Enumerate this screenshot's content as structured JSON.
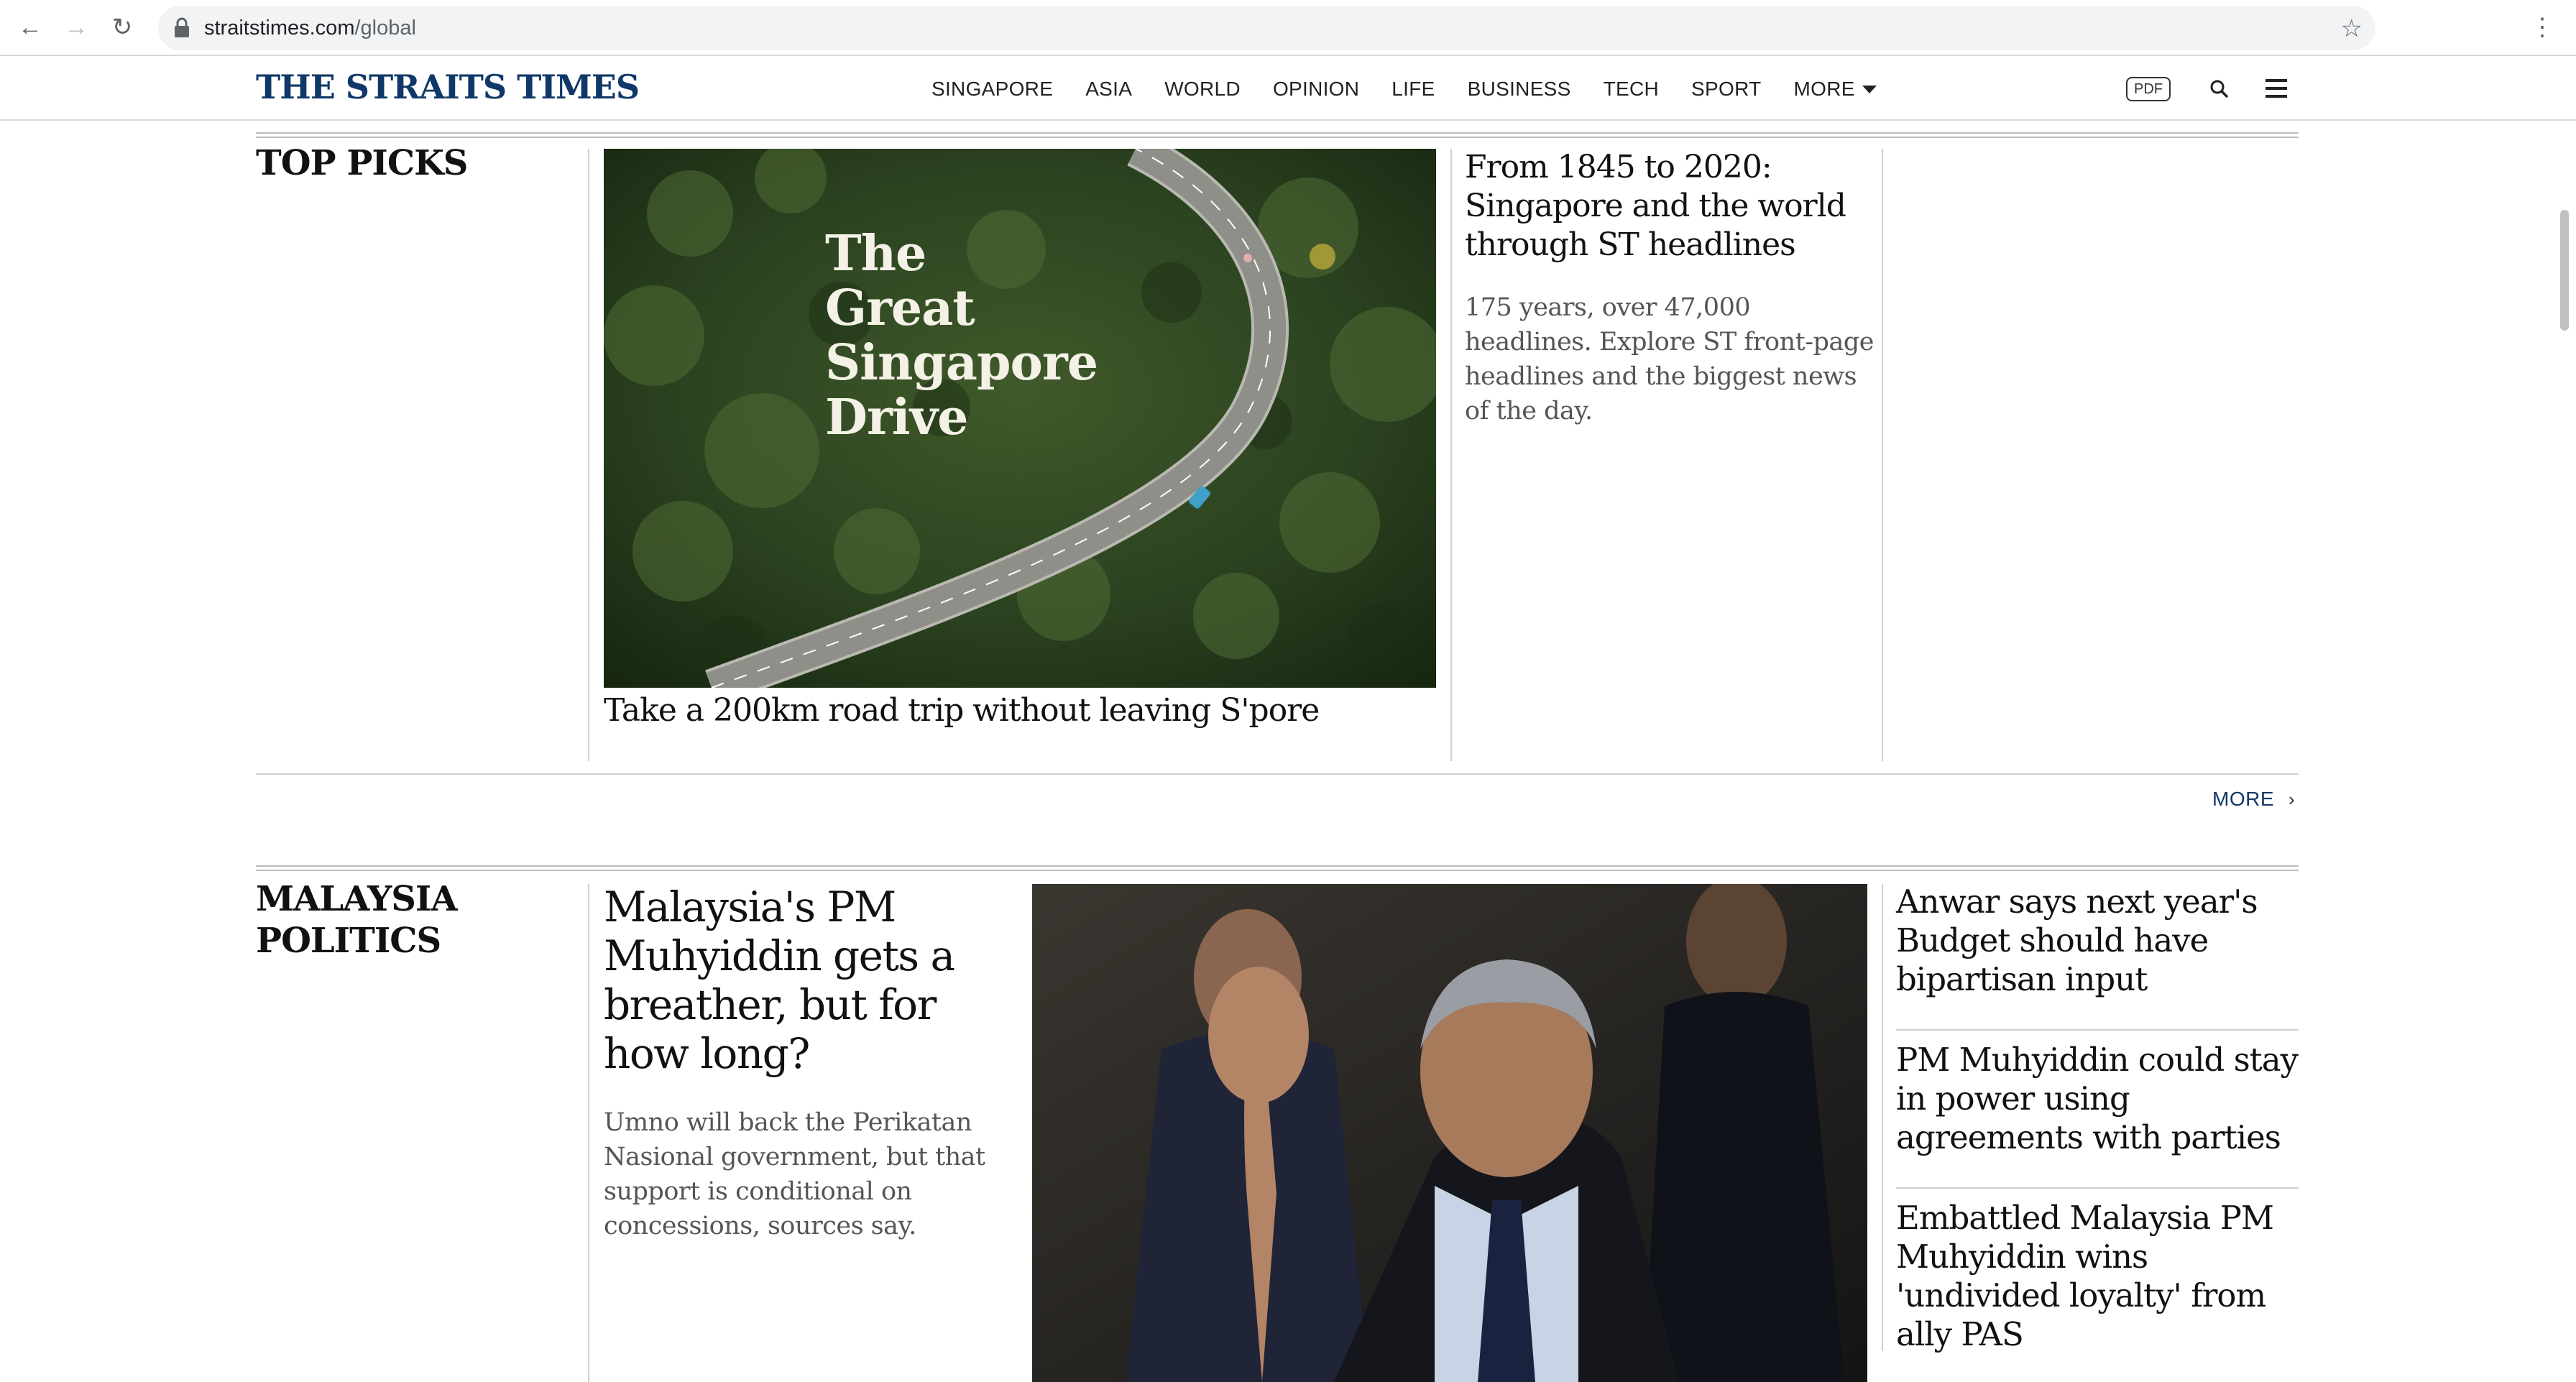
{
  "browser": {
    "url_host": "straitstimes.com",
    "url_path": "/global"
  },
  "site": {
    "logo": "THE STRAITS TIMES",
    "nav": [
      "SINGAPORE",
      "ASIA",
      "WORLD",
      "OPINION",
      "LIFE",
      "BUSINESS",
      "TECH",
      "SPORT"
    ],
    "nav_more": "MORE",
    "pdf_label": "PDF"
  },
  "top_picks": {
    "title": "TOP PICKS",
    "hero_overlay": [
      "The",
      "Great",
      "Singapore",
      "Drive"
    ],
    "hero_caption": "Take a 200km road trip without leaving S'pore",
    "feature_headline": "From 1845 to 2020: Singapore and the world through ST headlines",
    "feature_summary": "175 years, over 47,000 headlines. Explore ST front-page headlines and the biggest news of the day.",
    "more_label": "MORE"
  },
  "malaysia_politics": {
    "title_line1": "MALAYSIA",
    "title_line2": "POLITICS",
    "lead_headline": "Malaysia's PM Muhyiddin gets a breather, but for how long?",
    "lead_summary": "Umno will back the Perikatan Nasional government, but that support is conditional on concessions, sources say.",
    "side_stories": [
      "Anwar says next year's Budget should have bipartisan input",
      "PM Muhyiddin could stay in power using agreements with parties",
      "Embattled Malaysia PM Muhyiddin wins 'undivided loyalty' from ally PAS"
    ]
  },
  "colors": {
    "brand": "#0f3868",
    "rule": "#cfcfcf"
  }
}
